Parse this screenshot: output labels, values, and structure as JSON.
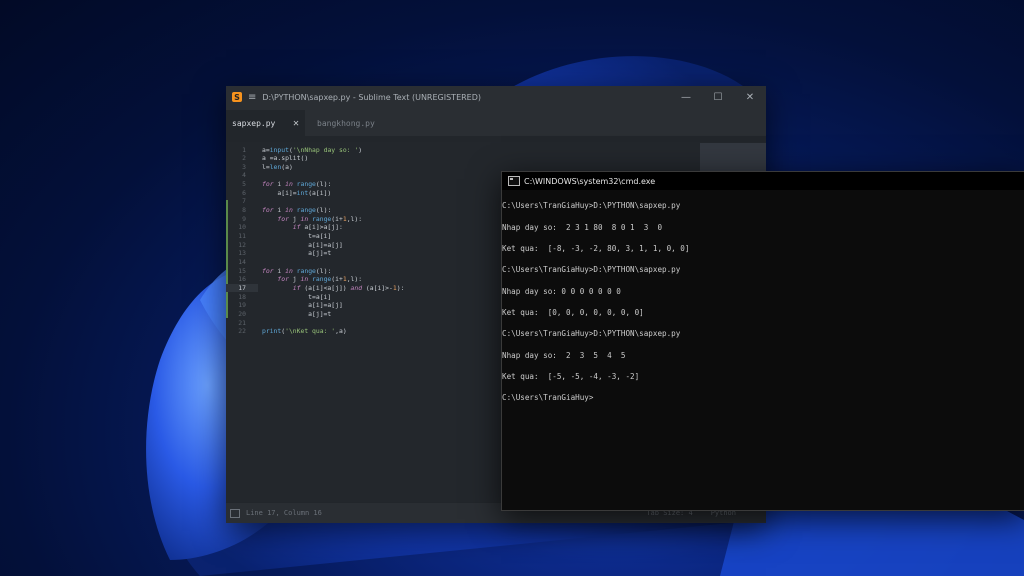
{
  "sublime": {
    "title": "D:\\PYTHON\\sapxep.py - Sublime Text (UNREGISTERED)",
    "menu_icon": "menu-icon",
    "window_controls": [
      "—",
      "☐",
      "✕"
    ],
    "tabs": [
      {
        "label": "sapxep.py",
        "close": "✕"
      },
      {
        "label": "bangkhong.py"
      }
    ],
    "code_lines": [
      {
        "n": "1",
        "text": "a=input('\\nNhap day so: ')"
      },
      {
        "n": "2",
        "text": "a =a.split()"
      },
      {
        "n": "3",
        "text": "l=len(a)"
      },
      {
        "n": "4",
        "text": ""
      },
      {
        "n": "5",
        "text": "for i in range(l):"
      },
      {
        "n": "6",
        "text": "    a[i]=int(a[i])"
      },
      {
        "n": "7",
        "text": ""
      },
      {
        "n": "8",
        "text": "for i in range(l):"
      },
      {
        "n": "9",
        "text": "    for j in range(i+1,l):"
      },
      {
        "n": "10",
        "text": "        if a[i]>a[j]:"
      },
      {
        "n": "11",
        "text": "            t=a[i]"
      },
      {
        "n": "12",
        "text": "            a[i]=a[j]"
      },
      {
        "n": "13",
        "text": "            a[j]=t"
      },
      {
        "n": "14",
        "text": ""
      },
      {
        "n": "15",
        "text": "for i in range(l):"
      },
      {
        "n": "16",
        "text": "    for j in range(i+1,l):"
      },
      {
        "n": "17",
        "text": "        if (a[i]<a[j]) and (a[i]>-1):"
      },
      {
        "n": "18",
        "text": "            t=a[i]"
      },
      {
        "n": "19",
        "text": "            a[i]=a[j]"
      },
      {
        "n": "20",
        "text": "            a[j]=t"
      },
      {
        "n": "21",
        "text": ""
      },
      {
        "n": "22",
        "text": "print('\\nKet qua: ',a)"
      }
    ],
    "status_left": "Line 17, Column 16",
    "status_tab_size": "Tab Size: 4",
    "status_syntax": "Python"
  },
  "cmd": {
    "title": "C:\\WINDOWS\\system32\\cmd.exe",
    "window_controls": [
      "—",
      "☐",
      "✕"
    ],
    "lines": [
      "C:\\Users\\TranGiaHuy>D:\\PYTHON\\sapxep.py",
      "Nhap day so:  2 3 1 80  8 0 1  3  0",
      "Ket qua:  [-8, -3, -2, 80, 3, 1, 1, 0, 0]",
      "C:\\Users\\TranGiaHuy>D:\\PYTHON\\sapxep.py",
      "Nhap day so: 0 0 0 0 0 0 0",
      "Ket qua:  [0, 0, 0, 0, 0, 0, 0]",
      "C:\\Users\\TranGiaHuy>D:\\PYTHON\\sapxep.py",
      "Nhap day so:  2  3  5  4  5",
      "Ket qua:  [-5, -5, -4, -3, -2]",
      "C:\\Users\\TranGiaHuy>"
    ]
  }
}
